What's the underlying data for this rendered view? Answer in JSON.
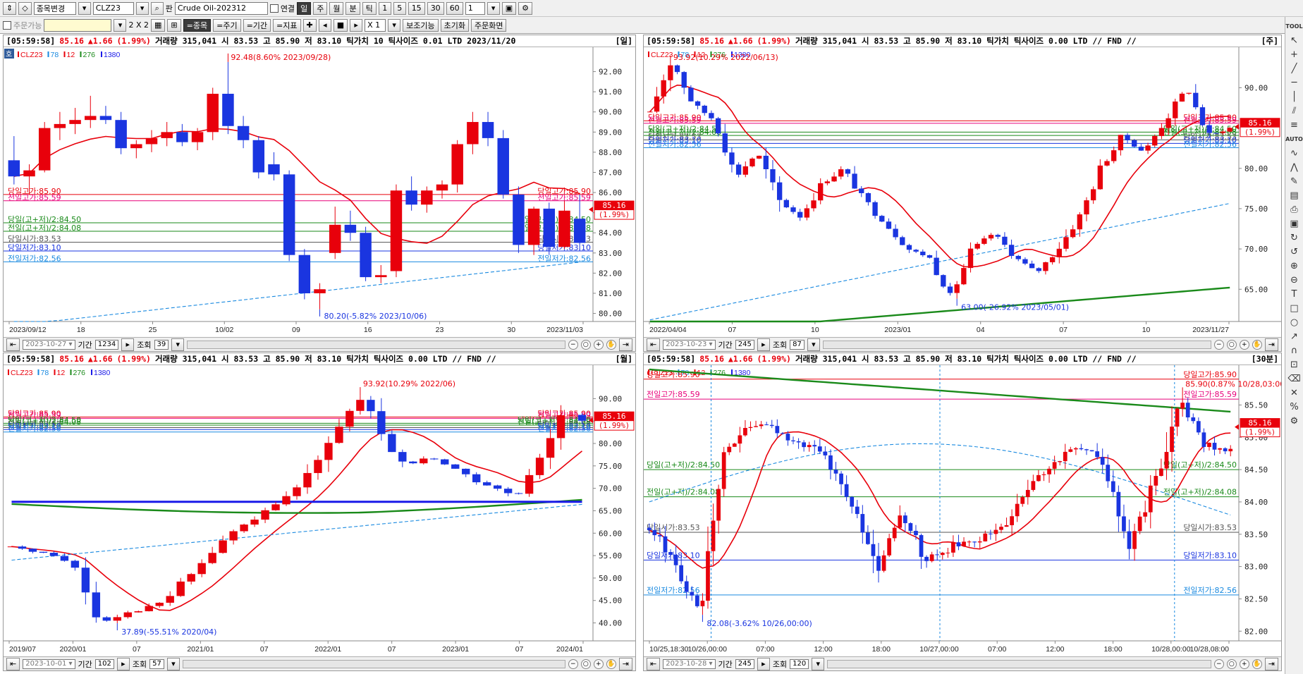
{
  "toolbar": {
    "mode_label": "종목변경",
    "symbol": "CLZ23",
    "search_icon": "search-icon",
    "plate_label": "판",
    "symbol_name": "Crude Oil-202312",
    "link_label": "연결",
    "periods": [
      "일",
      "주",
      "월",
      "분",
      "틱"
    ],
    "intervals": [
      "1",
      "5",
      "15",
      "30",
      "60"
    ],
    "interval_value": "1"
  },
  "toolbar2": {
    "order_label": "주문가능",
    "layout_label": "2 X 2",
    "btn_symbol": "=종목",
    "btn_cycle": "=주기",
    "btn_period": "=기간",
    "btn_indicator": "=지표",
    "multiplier": "X 1",
    "btn_aux": "보조기능",
    "btn_reset": "초기화",
    "btn_order": "주문화면"
  },
  "legend": {
    "symbol": "CLZ23",
    "ma1": "78",
    "ma2": "12",
    "ma3": "276",
    "ma4": "1380"
  },
  "colors": {
    "up": "#e8000b",
    "down": "#1a35e0",
    "ma_red": "#e8000b",
    "ma_blue_dash": "#1a8ae0",
    "ma_green": "#1a8a1a",
    "ma_navy": "#1a1ae8"
  },
  "panels": [
    {
      "time": "[05:59:58]",
      "price": "85.16",
      "change": "▲1.66",
      "pct": "(1.99%)",
      "info": "거래량 315,041  시 83.53  고 85.90  저 83.10  틱가치 10  틱사이즈 0.01  LTD 2023/11/20",
      "period": "[일]",
      "badge": "호",
      "x_labels": [
        "2023/09/12",
        "18",
        "25",
        "10/02",
        "09",
        "16",
        "23",
        "30",
        "2023/11/03"
      ],
      "y_labels": [
        "92.00",
        "91.00",
        "90.00",
        "89.00",
        "88.00",
        "87.00",
        "86.00",
        "85.00",
        "84.00",
        "83.00",
        "82.00",
        "81.00",
        "80.00"
      ],
      "hline_labels_left": [
        "당일고가:85.90",
        "전일고가:85.59",
        "당일(고+저)/2:84.50",
        "전일(고+저)/2:84.08",
        "당일시가:83.53",
        "당일저가:83.10",
        "전일저가:82.56"
      ],
      "hline_labels_right": [
        "당일고가:85.90",
        "전일고가:85.59",
        "당일(고+저)/2:84.50",
        "전일(고+저)/2:84.08",
        "당일시가:83.53",
        "당일저가:83.10",
        "전일저가:82.56"
      ],
      "high_ann": "92.48(8.60% 2023/09/28)",
      "low_ann": "80.20(-5.82% 2023/10/06)",
      "footer": {
        "date": "2023-10-27",
        "period_label": "기간",
        "period_value": "1234",
        "view_label": "조회",
        "view_value": "39"
      }
    },
    {
      "time": "[05:59:58]",
      "price": "85.16",
      "change": "▲1.66",
      "pct": "(1.99%)",
      "info": "거래량 315,041  시 83.53  고 85.90  저 83.10  틱가치 틱사이즈 0.00  LTD // FND //",
      "period": "[주]",
      "x_labels": [
        "2022/04/04",
        "07",
        "10",
        "2023/01",
        "04",
        "07",
        "10",
        "2023/11/27"
      ],
      "y_labels": [
        "90.00",
        "85.00",
        "80.00",
        "75.00",
        "70.00",
        "65.00"
      ],
      "hline_labels_left": [
        "당일고가:85.90",
        "전일고가:85.59",
        "당일(고+저)/2:84.50",
        "전일(고+저)/2:84.08",
        "당일시가:83.53",
        "당일저가:83.10",
        "전일저가:82.56"
      ],
      "hline_labels_right": [
        "당일고가:85.90",
        "전일고가:85.59",
        "당일(고+저)/2:84.50",
        "전일(고+저)/2:84.08",
        "당일시가:83.53",
        "당일저가:83.10",
        "전일저가:82.56"
      ],
      "high_ann": "93.92(10.29% 2022/06/13)",
      "low_ann": "63.00(-26.92% 2023/05/01)",
      "footer": {
        "date": "2023-10-23",
        "period_label": "기간",
        "period_value": "245",
        "view_label": "조회",
        "view_value": "87"
      }
    },
    {
      "time": "[05:59:58]",
      "price": "85.16",
      "change": "▲1.66",
      "pct": "(1.99%)",
      "info": "거래량 315,041  시 83.53  고 85.90  저 83.10  틱가치 틱사이즈 0.00  LTD // FND //",
      "period": "[월]",
      "x_labels": [
        "2019/07",
        "2020/01",
        "07",
        "2021/01",
        "07",
        "2022/01",
        "07",
        "2023/01",
        "07",
        "2024/01"
      ],
      "y_labels": [
        "90.00",
        "85.00",
        "80.00",
        "75.00",
        "70.00",
        "65.00",
        "60.00",
        "55.00",
        "50.00",
        "45.00",
        "40.00"
      ],
      "hline_labels_left": [
        "당일고가:85.90",
        "전일고가:85.59",
        "당일(고+저)/2:84.50",
        "전일(고+저)/2:84.08",
        "당일시가:83.53",
        "당일저가:83.10",
        "전일저가:82.56"
      ],
      "hline_labels_right": [
        "당일고가:85.90",
        "전일고가:85.59",
        "당일(고+저)/2:84.50",
        "전일(고+저)/2:84.08",
        "당일시가:83.53",
        "당일저가:83.10",
        "전일저가:82.56"
      ],
      "high_ann": "93.92(10.29% 2022/06)",
      "low_ann": "37.89(-55.51% 2020/04)",
      "footer": {
        "date": "2023-10-01",
        "period_label": "기간",
        "period_value": "102",
        "view_label": "조회",
        "view_value": "57"
      }
    },
    {
      "time": "[05:59:58]",
      "price": "85.16",
      "change": "▲1.66",
      "pct": "(1.99%)",
      "info": "거래량 315,041  시 83.53  고 85.90  저 83.10  틱가치 틱사이즈 0.00  LTD // FND //",
      "period": "[30분]",
      "x_labels": [
        "10/25,18:30",
        "10/26,00:00",
        "07:00",
        "12:00",
        "18:00",
        "10/27,00:00",
        "07:00",
        "12:00",
        "18:00",
        "10/28,00:00",
        "10/28,08:00"
      ],
      "y_labels": [
        "85.50",
        "85.00",
        "84.50",
        "84.00",
        "83.50",
        "83.00",
        "82.50",
        "82.00"
      ],
      "hline_labels_left": [
        "당일고가:85.90",
        "전일고가:85.59",
        "당일(고+저)/2:84.50",
        "전일(고+저)/2:84.08",
        "당일시가:83.53",
        "당일저가:83.10",
        "전일저가:82.56"
      ],
      "hline_labels_right": [
        "당일고가:85.90",
        "전일고가:85.59",
        "당일(고+저)/2:84.50",
        "전일(고+저)/2:84.08",
        "당일시가:83.53",
        "당일저가:83.10",
        "전일저가:82.56"
      ],
      "high_ann": "85.90(0.87% 10/28,03:00)",
      "low_ann": "82.08(-3.62% 10/26,00:00)",
      "footer": {
        "date": "2023-10-28",
        "period_label": "기간",
        "period_value": "245",
        "view_label": "조회",
        "view_value": "120"
      }
    }
  ],
  "sidebar": {
    "tool_label": "TOOL",
    "auto_label": "AUTO",
    "icons": [
      "cursor-icon",
      "crosshair-icon",
      "trendline-icon",
      "horizontal-line-icon",
      "vertical-line-icon",
      "channel-icon",
      "fibonacci-icon",
      "zoom-in-icon",
      "zoom-out-icon",
      "text-icon",
      "rectangle-icon",
      "ellipse-icon",
      "arrow-icon",
      "delete-icon",
      "settings-icon"
    ]
  },
  "chart_data": [
    {
      "type": "candlestick",
      "title": "CLZ23 일봉",
      "ylim": [
        79.6,
        93.0
      ],
      "levels": {
        "today_high": 85.9,
        "prev_high": 85.59,
        "today_mid": 84.5,
        "prev_mid": 84.08,
        "today_open": 83.53,
        "today_low": 83.1,
        "prev_low": 82.56
      },
      "last": 85.16,
      "last_pct": "1.99%",
      "candles": [
        [
          87.6,
          88.8,
          86.4,
          86.8
        ],
        [
          86.8,
          87.4,
          85.9,
          87.1
        ],
        [
          87.1,
          89.5,
          87.0,
          89.2
        ],
        [
          89.2,
          90.0,
          88.6,
          89.4
        ],
        [
          89.4,
          90.2,
          88.9,
          89.6
        ],
        [
          89.6,
          90.8,
          89.2,
          89.8
        ],
        [
          89.8,
          90.3,
          89.4,
          89.6
        ],
        [
          89.6,
          90.0,
          87.9,
          88.2
        ],
        [
          88.2,
          88.6,
          87.7,
          88.4
        ],
        [
          88.4,
          89.1,
          88.0,
          88.7
        ],
        [
          88.7,
          89.5,
          88.3,
          89.0
        ],
        [
          89.0,
          89.4,
          88.3,
          88.5
        ],
        [
          88.5,
          89.2,
          88.1,
          89.0
        ],
        [
          89.0,
          91.2,
          88.6,
          90.9
        ],
        [
          90.9,
          92.48,
          88.9,
          89.3
        ],
        [
          89.3,
          89.8,
          88.2,
          88.6
        ],
        [
          88.6,
          88.8,
          86.7,
          87.0
        ],
        [
          87.4,
          88.0,
          86.6,
          86.9
        ],
        [
          86.9,
          87.1,
          82.6,
          82.9
        ],
        [
          82.9,
          83.2,
          80.7,
          81.0
        ],
        [
          81.0,
          81.5,
          80.2,
          81.2
        ],
        [
          83.0,
          85.3,
          82.7,
          84.4
        ],
        [
          84.4,
          85.1,
          83.6,
          84.0
        ],
        [
          84.0,
          84.3,
          81.6,
          81.8
        ],
        [
          81.8,
          82.4,
          81.5,
          81.9
        ],
        [
          82.1,
          86.4,
          81.8,
          86.1
        ],
        [
          86.1,
          86.8,
          85.1,
          85.4
        ],
        [
          85.4,
          86.3,
          85.0,
          86.1
        ],
        [
          86.1,
          86.6,
          85.7,
          86.4
        ],
        [
          86.4,
          88.6,
          86.0,
          88.4
        ],
        [
          88.4,
          90.0,
          87.9,
          89.5
        ],
        [
          89.5,
          90.0,
          88.3,
          88.7
        ],
        [
          88.7,
          89.1,
          85.7,
          85.9
        ],
        [
          85.9,
          86.3,
          83.0,
          83.4
        ],
        [
          83.4,
          85.3,
          82.9,
          85.2
        ],
        [
          85.2,
          85.5,
          82.9,
          83.3
        ],
        [
          83.3,
          85.6,
          83.2,
          85.1
        ],
        [
          84.7,
          85.9,
          83.1,
          83.5
        ]
      ]
    },
    {
      "type": "candlestick",
      "title": "CLZ23 주봉",
      "ylim": [
        61.0,
        94.5
      ],
      "levels": {
        "today_high": 85.9,
        "prev_high": 85.59,
        "today_mid": 84.5,
        "prev_mid": 84.08,
        "today_open": 83.53,
        "today_low": 83.1,
        "prev_low": 82.56
      },
      "last": 85.16,
      "last_pct": "1.99%"
    },
    {
      "type": "candlestick",
      "title": "CLZ23 월봉",
      "ylim": [
        36.0,
        96.5
      ],
      "levels": {
        "today_high": 85.9,
        "prev_high": 85.59,
        "today_mid": 84.5,
        "prev_mid": 84.08,
        "today_open": 83.53,
        "today_low": 83.1,
        "prev_low": 82.56
      },
      "last": 85.16,
      "last_pct": "1.99%"
    },
    {
      "type": "candlestick",
      "title": "CLZ23 30분봉",
      "ylim": [
        81.85,
        86.05
      ],
      "levels": {
        "today_high": 85.9,
        "prev_high": 85.59,
        "today_mid": 84.5,
        "prev_mid": 84.08,
        "today_open": 83.53,
        "today_low": 83.1,
        "prev_low": 82.56
      },
      "last": 85.16,
      "last_pct": "1.99%"
    }
  ]
}
